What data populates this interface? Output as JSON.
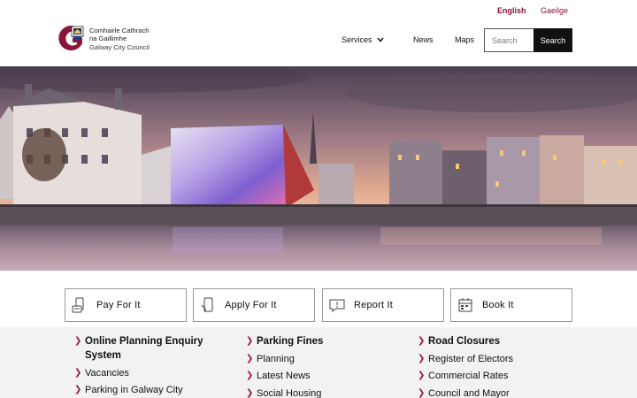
{
  "languages": {
    "english": "English",
    "irish": "Gaeilge"
  },
  "logo": {
    "line1": "Comhairle Cathrach",
    "line2": "na Gaillimhe",
    "line3": "Galway City Council"
  },
  "nav": {
    "services": "Services",
    "news": "News",
    "maps": "Maps"
  },
  "search": {
    "placeholder": "Search",
    "button": "Search"
  },
  "quick_links": [
    {
      "label": "Pay For It",
      "icon": "pay-icon"
    },
    {
      "label": "Apply For It",
      "icon": "apply-icon"
    },
    {
      "label": "Report It",
      "icon": "report-icon"
    },
    {
      "label": "Book It",
      "icon": "book-icon"
    }
  ],
  "links": {
    "col1": [
      "Online Planning Enquiry System",
      "Vacancies",
      "Parking in Galway City"
    ],
    "col2": [
      "Parking Fines",
      "Planning",
      "Latest News",
      "Social Housing"
    ],
    "col3": [
      "Road Closures",
      "Register of Electors",
      "Commercial Rates",
      "Council and Mayor"
    ]
  },
  "colors": {
    "brand": "#8a1538",
    "arrow": "#9b1a3a",
    "dark": "#111111"
  }
}
